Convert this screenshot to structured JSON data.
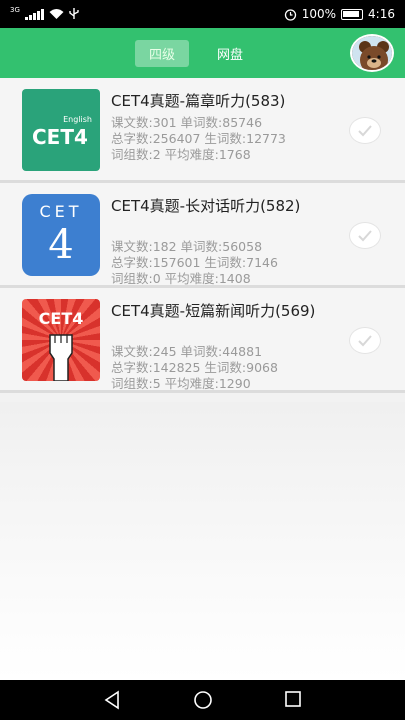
{
  "status_bar": {
    "network_label": "3G",
    "battery_percent": "100%",
    "time": "4:16",
    "icons": [
      "signal-icon",
      "wifi-icon",
      "usb-icon",
      "alarm-icon",
      "battery-icon"
    ]
  },
  "header": {
    "tabs": [
      {
        "label": "四级",
        "active": true
      },
      {
        "label": "网盘",
        "active": false
      }
    ],
    "avatar_icon": "bear-avatar-icon",
    "accent_color": "#33c16f"
  },
  "items": [
    {
      "title": "CET4真题-篇章听力(583)",
      "cover_text": "CET4",
      "cover_subtext": "English",
      "stats": [
        "课文数:301 单词数:85746",
        "总字数:256407 生词数:12773",
        "词组数:2 平均难度:1768"
      ]
    },
    {
      "title": "CET4真题-长对话听力(582)",
      "cover_text": "CET",
      "cover_number": "4",
      "stats": [
        "课文数:182 单词数:56058",
        "总字数:157601 生词数:7146",
        "词组数:0 平均难度:1408"
      ]
    },
    {
      "title": "CET4真题-短篇新闻听力(569)",
      "cover_text": "CET4",
      "stats": [
        "课文数:245 单词数:44881",
        "总字数:142825 生词数:9068",
        "词组数:5 平均难度:1290"
      ]
    }
  ],
  "nav_bar": {
    "icons": [
      "back-icon",
      "home-icon",
      "recents-icon"
    ]
  }
}
